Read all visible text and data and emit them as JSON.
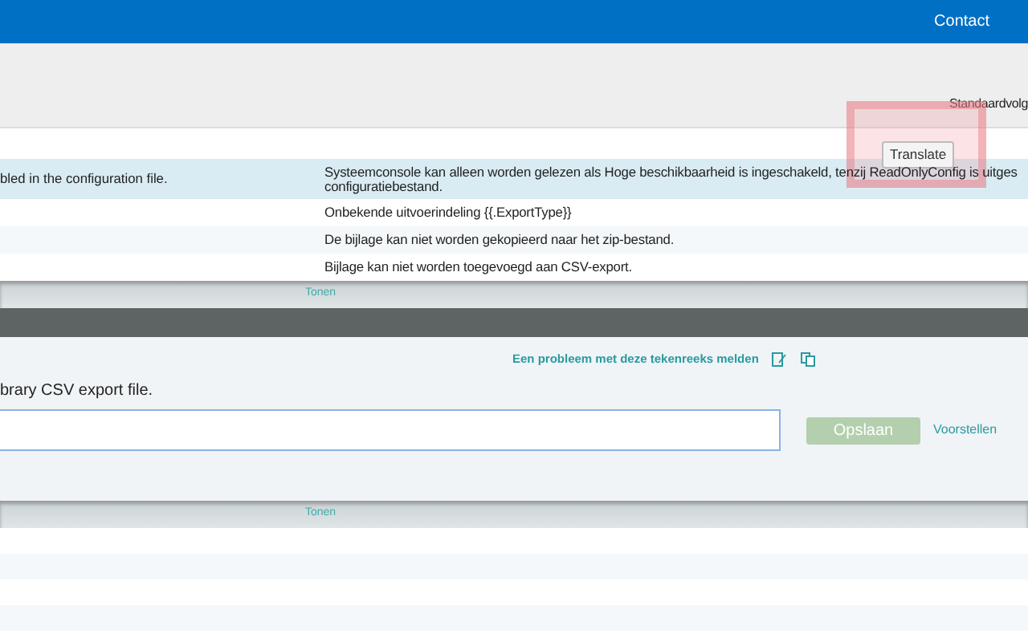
{
  "navbar": {
    "links": [
      "Contact"
    ]
  },
  "header": {
    "sort_label": "Standaardvolg"
  },
  "translate_button": {
    "label": "Translate"
  },
  "rows": [
    {
      "source": "bled in the configuration file.",
      "translation": "Systeemconsole kan alleen worden gelezen als Hoge beschikbaarheid is ingeschakeld, tenzij ReadOnlyConfig is uitges\nconfiguratiebestand.",
      "selected": true
    },
    {
      "translation": "Onbekende uitvoerindeling {{.ExportType}}",
      "selected": false
    },
    {
      "translation": "De bijlage kan niet worden gekopieerd naar het zip-bestand.",
      "selected": false
    },
    {
      "translation": "Bijlage kan niet worden toegevoegd aan CSV-export.",
      "selected": false
    }
  ],
  "show_bar_top": {
    "label": "Tonen"
  },
  "editor": {
    "report_link": "Een probleem met deze tekenreeks melden",
    "source": "brary CSV export file.",
    "save_button": "Opslaan",
    "save_disabled": true,
    "suggest_link": "Voorstellen"
  },
  "show_bar_bottom": {
    "label": "Tonen"
  }
}
